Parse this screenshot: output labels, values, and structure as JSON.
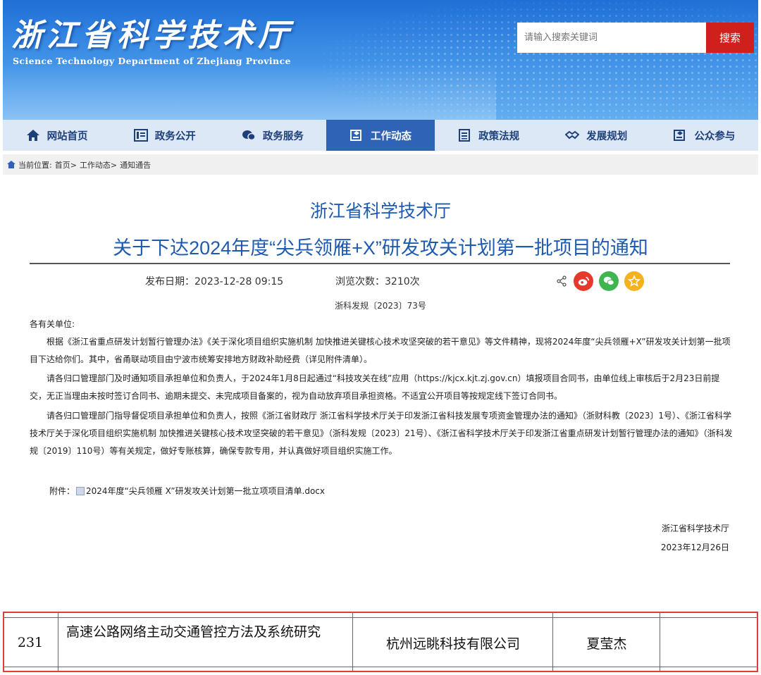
{
  "header": {
    "site_title": "浙江省科学技术厅",
    "site_subtitle": "Science Technology Department of Zhejiang Province",
    "search_placeholder": "请输入搜索关键词",
    "search_button": "搜索"
  },
  "nav": {
    "items": [
      {
        "label": "网站首页",
        "icon": "home-icon"
      },
      {
        "label": "政务公开",
        "icon": "list-icon"
      },
      {
        "label": "政务服务",
        "icon": "chat-icon"
      },
      {
        "label": "工作动态",
        "icon": "news-icon",
        "active": true
      },
      {
        "label": "政策法规",
        "icon": "document-icon"
      },
      {
        "label": "发展规划",
        "icon": "handshake-icon"
      },
      {
        "label": "公众参与",
        "icon": "people-icon"
      }
    ]
  },
  "breadcrumb": {
    "prefix": "当前位置:",
    "items": [
      "首页>",
      "工作动态>",
      "通知通告"
    ]
  },
  "article": {
    "org_title": "浙江省科学技术厅",
    "title": "关于下达2024年度“尖兵领雁+X”研发攻关计划第一批项目的通知",
    "publish_date": "发布日期：2023-12-28 09:15",
    "views": "浏览次数：3210次",
    "doc_number": "浙科发规〔2023〕73号",
    "salutation": "各有关单位:",
    "paragraphs": [
      "根据《浙江省重点研发计划暂行管理办法》《关于深化项目组织实施机制 加快推进关键核心技术攻坚突破的若干意见》等文件精神，现将2024年度“尖兵领雁+X”研发攻关计划第一批项目下达给你们。其中，省甬联动项目由宁波市统筹安排地方财政补助经费（详见附件清单）。",
      "请各归口管理部门及时通知项目承担单位和负责人，于2024年1月8日起通过“科技攻关在线”应用（https://kjcx.kjt.zj.gov.cn）填报项目合同书，由单位线上审核后于2月23日前提交，无正当理由未按时签订合同书、逾期未提交、未完成项目备案的，视为自动放弃项目承担资格。不适宜公开项目等按规定线下签订合同书。",
      "请各归口管理部门指导督促项目承担单位和负责人，按照《浙江省财政厅 浙江省科学技术厅关于印发浙江省科技发展专项资金管理办法的通知》（浙财科教〔2023〕1号）、《浙江省科学技术厅关于深化项目组织实施机制 加快推进关键核心技术攻坚突破的若干意见》（浙科发规〔2023〕21号）、《浙江省科学技术厅关于印发浙江省重点研发计划暂行管理办法的通知》（浙科发规〔2019〕110号）等有关规定，做好专账核算，确保专款专用，并认真做好项目组织实施工作。"
    ],
    "attachment_label": "附件：",
    "attachment_name": "2024年度“尖兵领雁 X”研发攻关计划第一批立项项目清单.docx",
    "signature_org": "浙江省科学技术厅",
    "signature_date": "2023年12月26日"
  },
  "table_row": {
    "number": "231",
    "project_name": "高速公路网络主动交通管控方法及系统研究",
    "organization": "杭州远眺科技有限公司",
    "leader": "夏莹杰"
  },
  "colors": {
    "nav_active": "#2f63b6",
    "title_blue": "#1e5bb0",
    "search_red": "#d0201b",
    "highlight_red": "#e53a3a"
  }
}
